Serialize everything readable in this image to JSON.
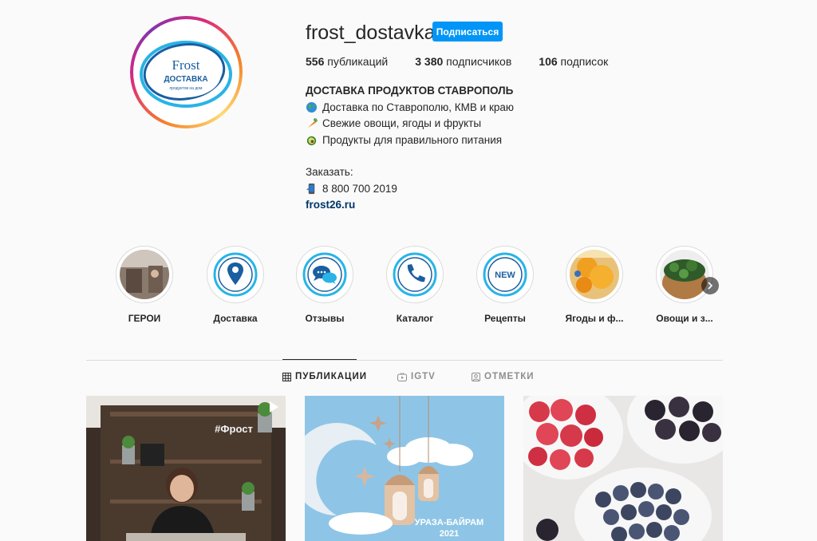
{
  "profile": {
    "username": "frost_dostavka",
    "follow_label": "Подписаться",
    "logo": {
      "brand": "Frost",
      "line1": "ДОСТАВКА",
      "line2": "продуктов на дом"
    },
    "stats": [
      {
        "count": "556",
        "label": " публикаций"
      },
      {
        "count": "3 380",
        "label": " подписчиков"
      },
      {
        "count": "106",
        "label": " подписок"
      }
    ],
    "bio": {
      "title": "ДОСТАВКА ПРОДУКТОВ СТАВРОПОЛЬ",
      "lines": [
        {
          "icon": "globe-emoji",
          "text": "Доставка по Ставрополю, КМВ и краю"
        },
        {
          "icon": "carrot-emoji",
          "text": "Свежие овощи, ягоды и фрукты"
        },
        {
          "icon": "avocado-emoji",
          "text": "Продукты для правильного питания"
        }
      ],
      "order_label": "Заказать:",
      "phone_icon": "mobile-phone-emoji",
      "phone": "8 800 700 2019",
      "link": "frost26.ru"
    }
  },
  "highlights": [
    {
      "label": "ГЕРОИ",
      "icon": "photo-thumbnail"
    },
    {
      "label": "Доставка",
      "icon": "location-pin-icon"
    },
    {
      "label": "Отзывы",
      "icon": "chat-bubbles-icon"
    },
    {
      "label": "Каталог",
      "icon": "phone-icon"
    },
    {
      "label": "Рецепты",
      "icon": "new-badge-icon",
      "badge": "NEW"
    },
    {
      "label": "Ягоды и ф...",
      "icon": "fruit-thumbnail"
    },
    {
      "label": "Овощи и з...",
      "icon": "greens-thumbnail"
    }
  ],
  "tabs": [
    {
      "label": "ПУБЛИКАЦИИ",
      "icon": "grid-icon",
      "active": true
    },
    {
      "label": "IGTV",
      "icon": "igtv-icon",
      "active": false
    },
    {
      "label": "ОТМЕТКИ",
      "icon": "tagged-icon",
      "active": false
    }
  ],
  "posts": [
    {
      "type": "video",
      "overlay_text": "#Фрост"
    },
    {
      "type": "image",
      "overlay_text": "УРАЗА-БАЙРАМ",
      "overlay_text2": "2021"
    },
    {
      "type": "image"
    }
  ],
  "colors": {
    "accent": "#0095f6",
    "link": "#00376b",
    "text": "#262626",
    "muted": "#8e8e8e",
    "brand_blue": "#1a5fa0",
    "brand_cyan": "#29b3e6"
  }
}
